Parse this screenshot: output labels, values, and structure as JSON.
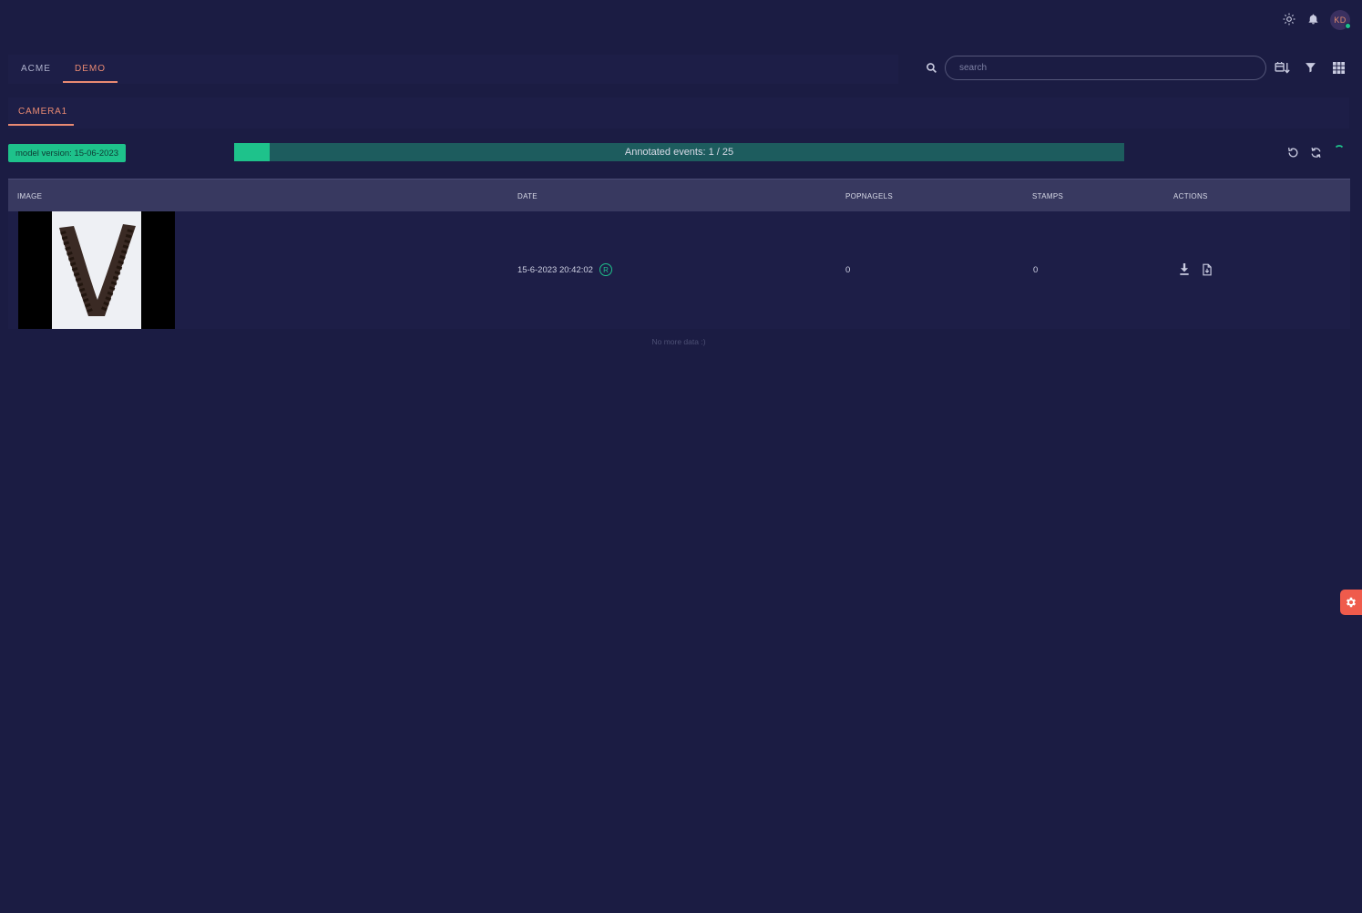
{
  "header": {
    "user_initials": "KD",
    "status_color": "#1ec28b"
  },
  "orgs": {
    "tabs": [
      {
        "label": "ACME",
        "active": false
      },
      {
        "label": "DEMO",
        "active": true
      }
    ]
  },
  "search": {
    "placeholder": "search"
  },
  "cameras": {
    "tabs": [
      {
        "label": "CAMERA1",
        "active": true
      }
    ]
  },
  "model": {
    "version_label": "model version: 15-06-2023"
  },
  "progress": {
    "label": "Annotated events: 1 / 25",
    "annotated": 1,
    "total": 25
  },
  "table": {
    "columns": [
      "IMAGE",
      "DATE",
      "POPNAGELS",
      "STAMPS",
      "ACTIONS"
    ],
    "rows": [
      {
        "image": "coffee-beans-v-shape",
        "date": "15-6-2023 20:42:02",
        "badge": "R",
        "popnagels": "0",
        "stamps": "0",
        "actions": [
          "download-icon",
          "file-download-icon"
        ]
      }
    ]
  },
  "footer": {
    "no_more": "No more data :)"
  },
  "colors": {
    "accent": "#e98a72",
    "success": "#1ec28b",
    "background": "#1b1c43",
    "fab": "#ef5b4c"
  }
}
